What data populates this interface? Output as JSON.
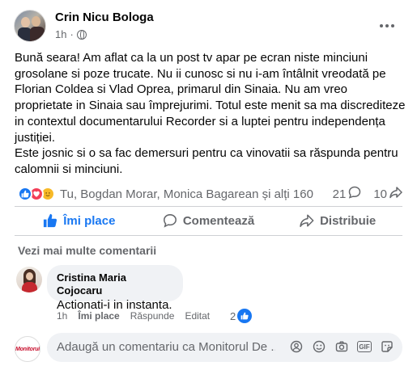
{
  "post": {
    "author": "Crin Nicu Bologa",
    "time": "1h",
    "separator": "·",
    "paragraphs": [
      "Bună seara! Am aflat ca la un post tv apar pe ecran niste minciuni grosolane si poze trucate. Nu ii cunosc si nu i-am întâlnit vreodată pe Florian Coldea si Vlad Oprea, primarul din Sinaia. Nu am vreo proprietate in Sinaia sau împrejurimi. Totul este menit sa ma discrediteze in contextul documentarului Recorder si a luptei pentru independența justiției.",
      "Este josnic si o sa fac demersuri pentru ca vinovatii sa  răspunda pentru calomnii si minciuni."
    ],
    "reactions_text": "Tu, Bogdan Morar, Monica Bagarean și alți 160",
    "comments_count": "21",
    "shares_count": "10"
  },
  "actions": {
    "like": "Îmi place",
    "comment": "Comentează",
    "share": "Distribuie"
  },
  "more_comments": "Vezi mai multe comentarii",
  "comment": {
    "author": "Cristina Maria Cojocaru",
    "text": "Actionati-i in instanta.",
    "time": "1h",
    "like": "Îmi place",
    "reply": "Răspunde",
    "edited": "Editat",
    "reactions_count": "2"
  },
  "composer": {
    "placeholder": "Adaugă un comentariu ca Monitorul De ...",
    "avatar_text": "Monitorul"
  },
  "colors": {
    "accent": "#1877f2",
    "secondary_text": "#65676b",
    "bubble": "#f0f2f5"
  },
  "icons": [
    "more-icon",
    "globe-icon",
    "like-reaction-icon",
    "love-reaction-icon",
    "care-reaction-icon",
    "comment-icon",
    "share-icon",
    "thumbs-up-icon",
    "emoji-icon",
    "camera-icon",
    "gif-icon",
    "sticker-icon",
    "avatar-sticker-icon"
  ]
}
